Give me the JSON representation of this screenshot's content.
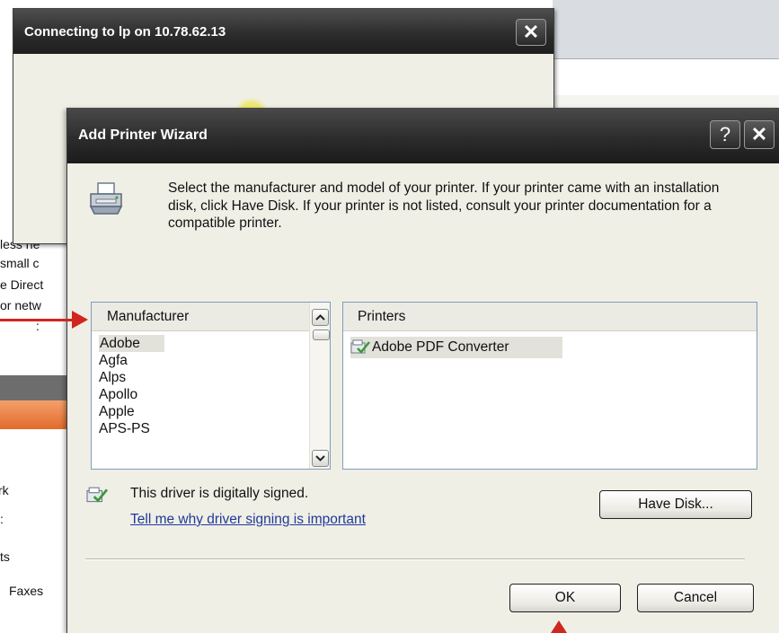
{
  "background": {
    "left_items": [
      {
        "text": "less ne",
        "top": 0
      },
      {
        "text": "small c",
        "top": 0
      },
      {
        "text": "e Direct",
        "top": 0
      },
      {
        "text": "or netw",
        "top": 0
      },
      {
        "text": ":",
        "top": 0
      },
      {
        "text": "rk",
        "top": 0
      },
      {
        "text": ":",
        "top": 0
      },
      {
        "text": "ts",
        "top": 0
      },
      {
        "text": "Faxes",
        "top": 0
      }
    ]
  },
  "connecting_dialog": {
    "title": "Connecting to lp on 10.78.62.13",
    "close_glyph": "✕"
  },
  "wizard": {
    "title": "Add Printer Wizard",
    "help_glyph": "?",
    "close_glyph": "✕",
    "intro_text": "Select the manufacturer and model of your printer. If your printer came with an installation disk, click Have Disk. If your printer is not listed, consult your printer documentation for a compatible printer.",
    "manufacturer_header": "Manufacturer",
    "manufacturers": [
      "Adobe",
      "Agfa",
      "Alps",
      "Apollo",
      "Apple",
      "APS-PS"
    ],
    "selected_manufacturer": "Adobe",
    "printers_header": "Printers",
    "printers": [
      "Adobe PDF Converter"
    ],
    "signed_text": "This driver is digitally signed.",
    "signed_link": "Tell me why driver signing is important",
    "have_disk_label": "Have Disk...",
    "ok_label": "OK",
    "cancel_label": "Cancel"
  },
  "colors": {
    "title_bar": "#2b2b2b",
    "dialog_bg": "#f0efe6",
    "annotation_arrow": "#d0261d",
    "link": "#1f3a9a"
  },
  "icons": [
    "printer-icon",
    "signed-driver-icon",
    "close-icon",
    "help-icon",
    "scroll-up-icon",
    "scroll-down-icon"
  ]
}
